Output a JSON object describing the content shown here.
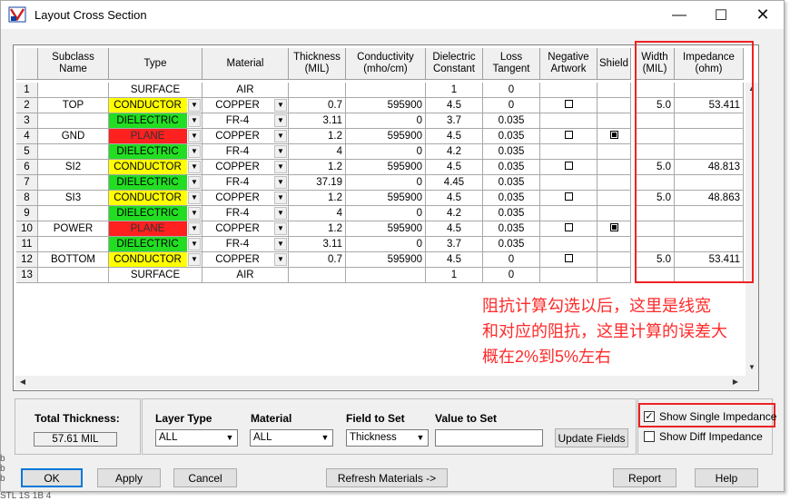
{
  "window": {
    "title": "Layout Cross Section"
  },
  "columns": [
    "",
    "Subclass\nName",
    "Type",
    "Material",
    "Thickness\n(MIL)",
    "Conductivity\n(mho/cm)",
    "Dielectric\nConstant",
    "Loss\nTangent",
    "Negative\nArtwork",
    "Shield",
    "Width\n(MIL)",
    "Impedance\n(ohm)"
  ],
  "rows": [
    {
      "n": "1",
      "name": "",
      "type": "SURFACE",
      "material": "AIR",
      "thick": "",
      "cond": "",
      "dk": "1",
      "loss": "0",
      "neg": "",
      "shield": "",
      "width": "",
      "imp": ""
    },
    {
      "n": "2",
      "name": "TOP",
      "type": "CONDUCTOR",
      "material": "COPPER",
      "thick": "0.7",
      "cond": "595900",
      "dk": "4.5",
      "loss": "0",
      "neg": "off",
      "shield": "",
      "width": "5.0",
      "imp": "53.411"
    },
    {
      "n": "3",
      "name": "",
      "type": "DIELECTRIC",
      "material": "FR-4",
      "thick": "3.11",
      "cond": "0",
      "dk": "3.7",
      "loss": "0.035",
      "neg": "",
      "shield": "",
      "width": "",
      "imp": ""
    },
    {
      "n": "4",
      "name": "GND",
      "type": "PLANE",
      "material": "COPPER",
      "thick": "1.2",
      "cond": "595900",
      "dk": "4.5",
      "loss": "0.035",
      "neg": "off",
      "shield": "on",
      "width": "",
      "imp": ""
    },
    {
      "n": "5",
      "name": "",
      "type": "DIELECTRIC",
      "material": "FR-4",
      "thick": "4",
      "cond": "0",
      "dk": "4.2",
      "loss": "0.035",
      "neg": "",
      "shield": "",
      "width": "",
      "imp": ""
    },
    {
      "n": "6",
      "name": "SI2",
      "type": "CONDUCTOR",
      "material": "COPPER",
      "thick": "1.2",
      "cond": "595900",
      "dk": "4.5",
      "loss": "0.035",
      "neg": "off",
      "shield": "",
      "width": "5.0",
      "imp": "48.813"
    },
    {
      "n": "7",
      "name": "",
      "type": "DIELECTRIC",
      "material": "FR-4",
      "thick": "37.19",
      "cond": "0",
      "dk": "4.45",
      "loss": "0.035",
      "neg": "",
      "shield": "",
      "width": "",
      "imp": ""
    },
    {
      "n": "8",
      "name": "SI3",
      "type": "CONDUCTOR",
      "material": "COPPER",
      "thick": "1.2",
      "cond": "595900",
      "dk": "4.5",
      "loss": "0.035",
      "neg": "off",
      "shield": "",
      "width": "5.0",
      "imp": "48.863"
    },
    {
      "n": "9",
      "name": "",
      "type": "DIELECTRIC",
      "material": "FR-4",
      "thick": "4",
      "cond": "0",
      "dk": "4.2",
      "loss": "0.035",
      "neg": "",
      "shield": "",
      "width": "",
      "imp": ""
    },
    {
      "n": "10",
      "name": "POWER",
      "type": "PLANE",
      "material": "COPPER",
      "thick": "1.2",
      "cond": "595900",
      "dk": "4.5",
      "loss": "0.035",
      "neg": "off",
      "shield": "on",
      "width": "",
      "imp": ""
    },
    {
      "n": "11",
      "name": "",
      "type": "DIELECTRIC",
      "material": "FR-4",
      "thick": "3.11",
      "cond": "0",
      "dk": "3.7",
      "loss": "0.035",
      "neg": "",
      "shield": "",
      "width": "",
      "imp": ""
    },
    {
      "n": "12",
      "name": "BOTTOM",
      "type": "CONDUCTOR",
      "material": "COPPER",
      "thick": "0.7",
      "cond": "595900",
      "dk": "4.5",
      "loss": "0",
      "neg": "off",
      "shield": "",
      "width": "5.0",
      "imp": "53.411"
    },
    {
      "n": "13",
      "name": "",
      "type": "SURFACE",
      "material": "AIR",
      "thick": "",
      "cond": "",
      "dk": "1",
      "loss": "0",
      "neg": "",
      "shield": "",
      "width": "",
      "imp": ""
    }
  ],
  "type_colors": {
    "CONDUCTOR": "#ffff00",
    "DIELECTRIC": "#22dd22",
    "PLANE": "#ff2020",
    "SURFACE": "#ffffff"
  },
  "annotation": {
    "line1": "阻抗计算勾选以后，这里是线宽",
    "line2": "和对应的阻抗，这里计算的误差大",
    "line3": "概在2%到5%左右",
    "color": "#ff2a2a"
  },
  "bottom": {
    "total_label": "Total Thickness:",
    "total_value": "57.61 MIL",
    "layer_type_label": "Layer Type",
    "layer_type_value": "ALL",
    "material_label": "Material",
    "material_value": "ALL",
    "field_label": "Field to Set",
    "field_value": "Thickness",
    "value_label": "Value to Set",
    "value_value": "",
    "update_button": "Update Fields",
    "single_imp": "Show Single Impedance",
    "diff_imp": "Show Diff Impedance"
  },
  "buttons": {
    "ok": "OK",
    "apply": "Apply",
    "cancel": "Cancel",
    "refresh": "Refresh Materials ->",
    "report": "Report",
    "help": "Help"
  },
  "status": {
    "l1": "b",
    "l2": "b",
    "l3": "b",
    "l4": "STL 1S 1B 4"
  }
}
